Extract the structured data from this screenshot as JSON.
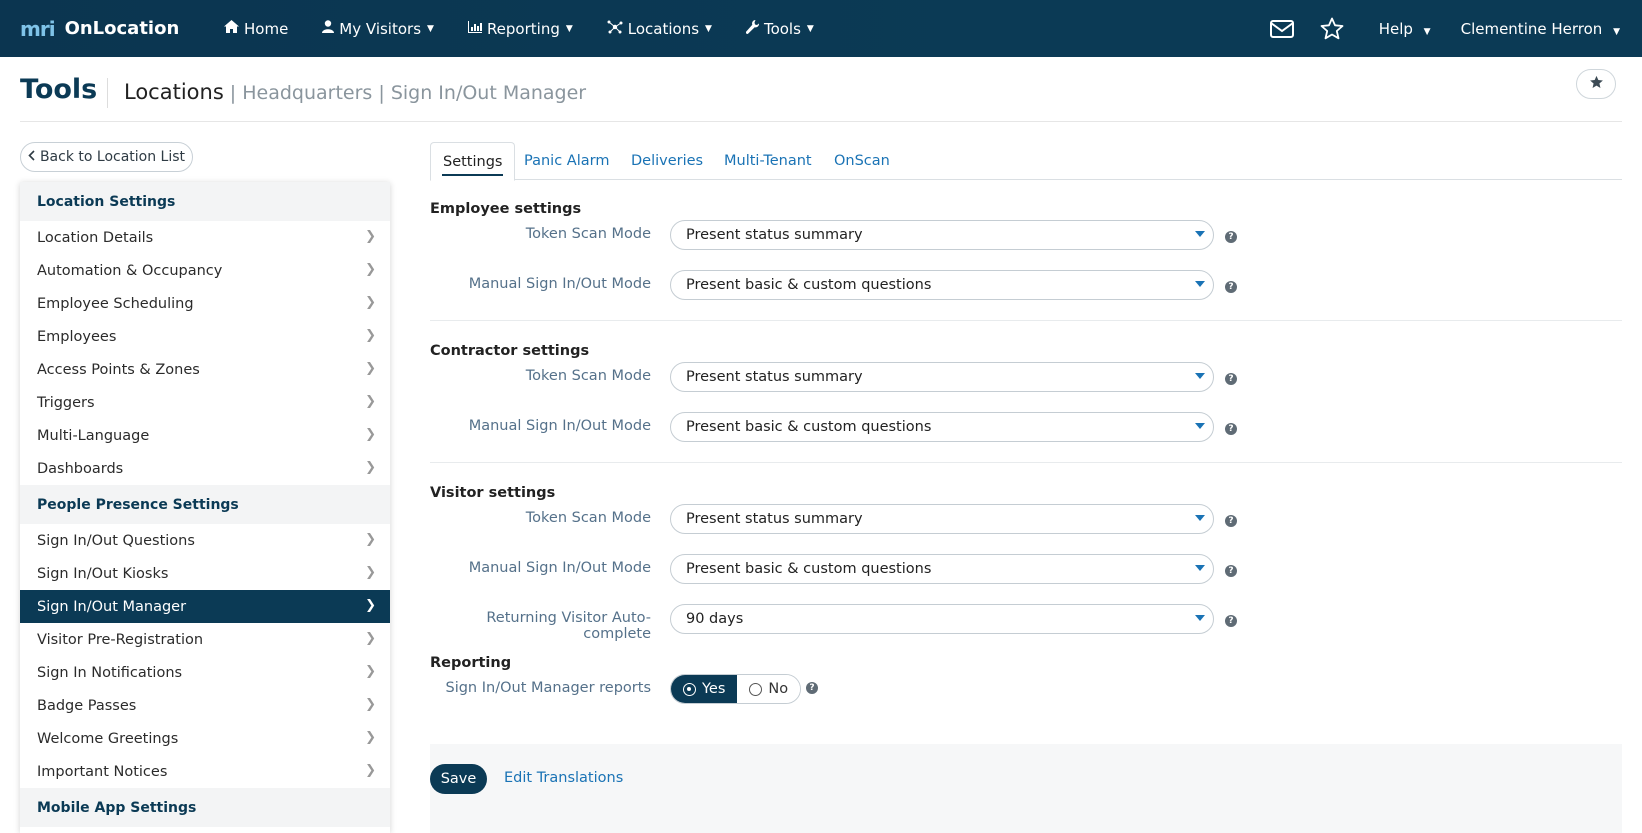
{
  "topnav": {
    "logo": "mri",
    "brand": "OnLocation",
    "items": [
      {
        "label": "Home",
        "icon": "home-icon"
      },
      {
        "label": "My Visitors",
        "icon": "user-icon"
      },
      {
        "label": "Reporting",
        "icon": "bar-chart-icon"
      },
      {
        "label": "Locations",
        "icon": "locations-icon"
      },
      {
        "label": "Tools",
        "icon": "wrench-icon"
      }
    ],
    "help": "Help",
    "user": "Clementine Herron"
  },
  "header": {
    "title": "Tools",
    "crumb_main": "Locations",
    "crumb_rest": " | Headquarters | Sign In/Out Manager"
  },
  "back_button": "Back to Location List",
  "sidebar": {
    "sections": [
      {
        "title": "Location Settings",
        "items": [
          "Location Details",
          "Automation & Occupancy",
          "Employee Scheduling",
          "Employees",
          "Access Points & Zones",
          "Triggers",
          "Multi-Language",
          "Dashboards"
        ]
      },
      {
        "title": "People Presence Settings",
        "items": [
          "Sign In/Out Questions",
          "Sign In/Out Kiosks",
          "Sign In/Out Manager",
          "Visitor Pre-Registration",
          "Sign In Notifications",
          "Badge Passes",
          "Welcome Greetings",
          "Important Notices"
        ]
      },
      {
        "title": "Mobile App Settings",
        "items": []
      }
    ],
    "active_item": "Sign In/Out Manager"
  },
  "tabs": [
    "Settings",
    "Panic Alarm",
    "Deliveries",
    "Multi-Tenant",
    "OnScan"
  ],
  "active_tab": "Settings",
  "employee": {
    "title": "Employee settings",
    "token_label": "Token Scan Mode",
    "token_value": "Present status summary",
    "manual_label": "Manual Sign In/Out Mode",
    "manual_value": "Present basic & custom questions"
  },
  "contractor": {
    "title": "Contractor settings",
    "token_label": "Token Scan Mode",
    "token_value": "Present status summary",
    "manual_label": "Manual Sign In/Out Mode",
    "manual_value": "Present basic & custom questions"
  },
  "visitor": {
    "title": "Visitor settings",
    "token_label": "Token Scan Mode",
    "token_value": "Present status summary",
    "manual_label": "Manual Sign In/Out Mode",
    "manual_value": "Present basic & custom questions",
    "returning_label": "Returning Visitor Auto-complete",
    "returning_value": "90 days"
  },
  "reporting": {
    "title": "Reporting",
    "reports_label": "Sign In/Out Manager reports",
    "yes": "Yes",
    "no": "No",
    "selected": "Yes"
  },
  "footer": {
    "save": "Save",
    "edit_translations": "Edit Translations"
  },
  "help_glyph": "?",
  "colors": {
    "nav_bg": "#0b3a55",
    "link": "#1a73b5",
    "active_bg": "#0b3a55"
  }
}
